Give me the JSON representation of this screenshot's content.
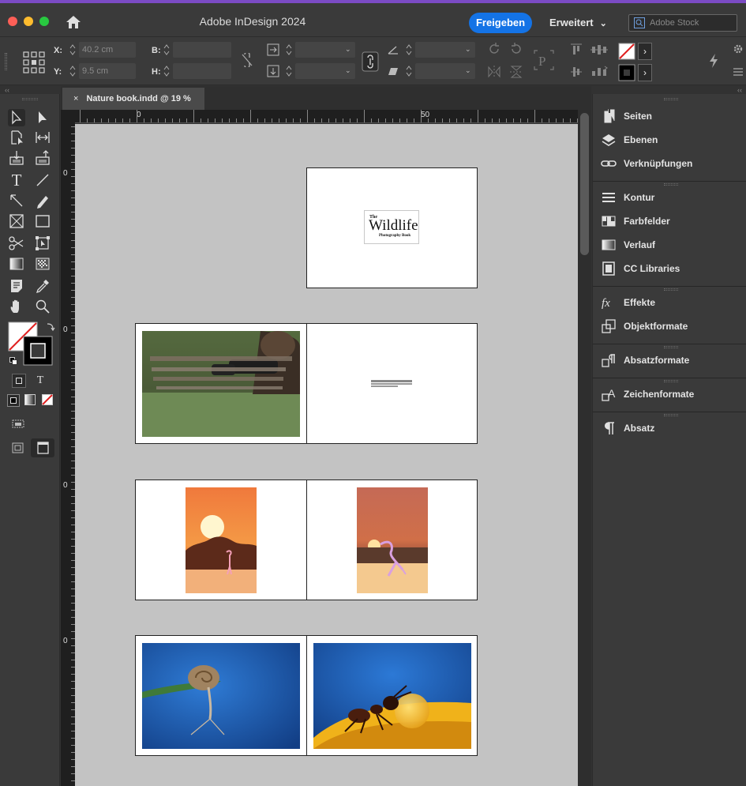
{
  "window": {
    "app_title": "Adobe InDesign 2024",
    "share_label": "Freigeben",
    "workspace_label": "Erweitert",
    "stock_search_placeholder": "Adobe Stock"
  },
  "control_bar": {
    "x_label": "X:",
    "x_value": "40.2 cm",
    "y_label": "Y:",
    "y_value": "9.5 cm",
    "w_label": "B:",
    "w_value": "",
    "h_label": "H:",
    "h_value": ""
  },
  "document": {
    "tab_label": "Nature book.indd @ 19 %",
    "close_glyph": "×",
    "ruler_h_labels": [
      "0",
      "50"
    ],
    "ruler_v_labels": [
      "0",
      "0",
      "0",
      "0"
    ],
    "cover_text": {
      "the": "The",
      "title": "Wildlife",
      "subtitle": "Photography Book"
    }
  },
  "right_panel": {
    "groups": [
      {
        "items": [
          {
            "label": "Seiten",
            "icon": "pages-icon"
          },
          {
            "label": "Ebenen",
            "icon": "layers-icon"
          },
          {
            "label": "Verknüpfungen",
            "icon": "links-icon"
          }
        ]
      },
      {
        "items": [
          {
            "label": "Kontur",
            "icon": "stroke-icon"
          },
          {
            "label": "Farbfelder",
            "icon": "swatches-icon"
          },
          {
            "label": "Verlauf",
            "icon": "gradient-icon"
          },
          {
            "label": "CC Libraries",
            "icon": "cc-libraries-icon"
          }
        ]
      },
      {
        "items": [
          {
            "label": "Effekte",
            "icon": "fx-icon"
          },
          {
            "label": "Objektformate",
            "icon": "object-styles-icon"
          }
        ]
      },
      {
        "items": [
          {
            "label": "Absatzformate",
            "icon": "paragraph-styles-icon"
          }
        ]
      },
      {
        "items": [
          {
            "label": "Zeichenformate",
            "icon": "character-styles-icon"
          }
        ]
      },
      {
        "items": [
          {
            "label": "Absatz",
            "icon": "paragraph-icon"
          }
        ]
      }
    ]
  },
  "toolbar": {
    "type_tool_glyph": "T",
    "text_format_glyph": "T"
  }
}
